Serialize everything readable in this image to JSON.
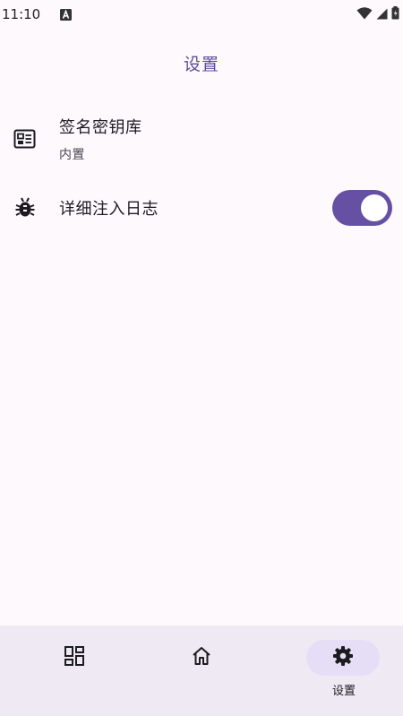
{
  "status_bar": {
    "time": "11:10",
    "notification_icon": "a-letter-icon",
    "wifi_icon": "wifi-icon",
    "signal_icon": "signal-icon",
    "battery_icon": "battery-icon"
  },
  "header": {
    "title": "设置"
  },
  "settings": {
    "keystore": {
      "icon": "keystore-card-icon",
      "title": "签名密钥库",
      "subtitle": "内置"
    },
    "verbose_log": {
      "icon": "bug-icon",
      "title": "详细注入日志",
      "enabled": true
    }
  },
  "bottom_nav": {
    "items": [
      {
        "icon": "dashboard-grid-icon",
        "label": "",
        "active": false
      },
      {
        "icon": "home-icon",
        "label": "",
        "active": false
      },
      {
        "icon": "gear-icon",
        "label": "设置",
        "active": true
      }
    ]
  },
  "colors": {
    "accent": "#6650a4",
    "title": "#5f4a9e",
    "background": "#fdf9fd",
    "nav_background": "#efe9f3",
    "nav_active_pill": "#e6def7"
  }
}
